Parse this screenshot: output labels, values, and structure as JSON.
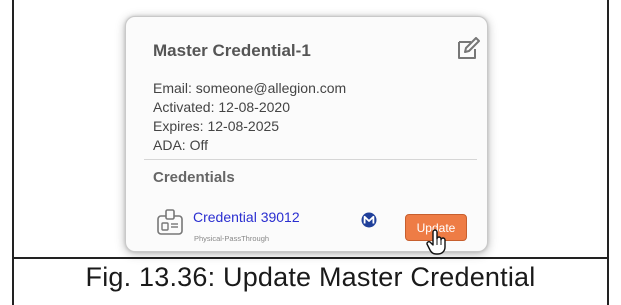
{
  "card": {
    "title": "Master Credential-1",
    "email": "Email: someone@allegion.com",
    "activated": "Activated: 12-08-2020",
    "expires": "Expires: 12-08-2025",
    "ada": "ADA: Off",
    "edit_icon": "edit-icon"
  },
  "credentials": {
    "section_title": "Credentials",
    "items": [
      {
        "name": "Credential 39012",
        "type": "Physical-PassThrough",
        "icon": "credential-card-icon",
        "badge_icon": "m-badge-icon",
        "action_label": "Update"
      }
    ]
  },
  "caption": "Fig. 13.36: Update Master Credential",
  "colors": {
    "button": "#ee7c45",
    "link": "#2a2ed0",
    "badge": "#1f3f9a"
  }
}
